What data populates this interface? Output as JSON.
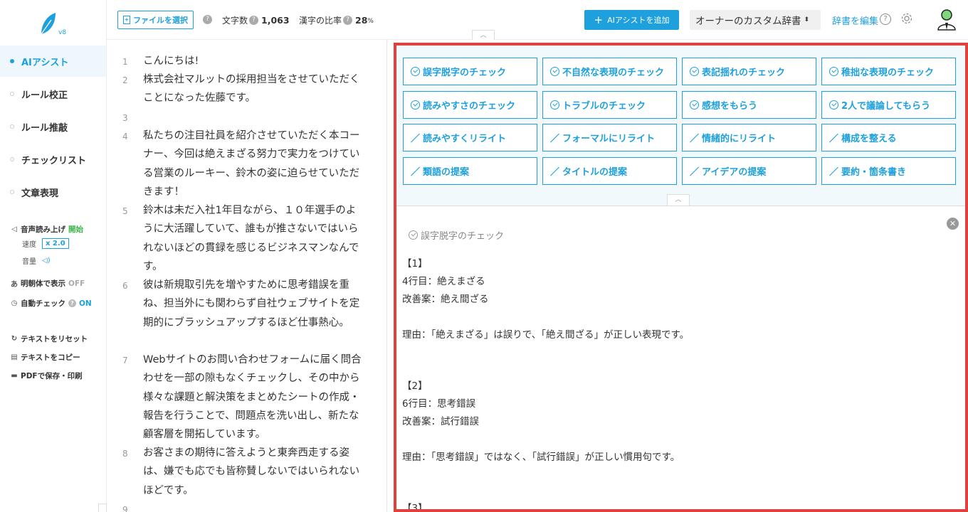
{
  "app": {
    "version": "v8",
    "brand_color": "#1ea0dc",
    "highlight_color": "#e0413c"
  },
  "sidebar": {
    "nav": [
      {
        "label": "AIアシスト",
        "active": true
      },
      {
        "label": "ルール校正",
        "active": false
      },
      {
        "label": "ルール推敲",
        "active": false
      },
      {
        "label": "チェックリスト",
        "active": false
      },
      {
        "label": "文章表現",
        "active": false
      }
    ],
    "tts": {
      "label": "音声読み上げ",
      "action": "開始",
      "speed_label": "速度",
      "speed_value": "x 2.0",
      "volume_label": "音量"
    },
    "mincho": {
      "label": "明朝体で表示",
      "state": "OFF"
    },
    "auto_check": {
      "label": "自動チェック",
      "state": "ON"
    },
    "actions": [
      {
        "label": "テキストをリセット",
        "icon": "reset-icon"
      },
      {
        "label": "テキストをコピー",
        "icon": "copy-icon"
      },
      {
        "label": "PDFで保存・印刷",
        "icon": "print-icon"
      }
    ]
  },
  "header": {
    "file_button": "ファイルを選択",
    "char_count_label": "文字数",
    "char_count_value": "1,063",
    "kanji_ratio_label": "漢字の比率",
    "kanji_ratio_value": "28",
    "kanji_ratio_unit": "%",
    "ai_add_button": "AIアシストを追加",
    "dict_select": "オーナーのカスタム辞書",
    "dict_edit_link": "辞書を編集"
  },
  "editor": {
    "lines": [
      {
        "num": "1",
        "text": "こんにちは!"
      },
      {
        "num": "2",
        "text": "株式会社マルットの採用担当をさせていただくことになった佐藤です。"
      },
      {
        "num": "3",
        "text": ""
      },
      {
        "num": "4",
        "text": "私たちの注目社員を紹介させていただく本コーナー、今回は絶えまざる努力で実力をつけている営業のルーキー、鈴木の姿に迫らせていただきます！"
      },
      {
        "num": "5",
        "text": "鈴木は未だ入社1年目ながら、１０年選手のように大活躍していて、誰もが推さないではいられないほどの貫録を感じるビジネスマンなんです。"
      },
      {
        "num": "6",
        "text": "彼は新規取引先を増やすために思考錯誤を重ね、担当外にも関わらず自社ウェブサイトを定期的にブラッシュアップするほど仕事熱心。"
      },
      {
        "num": "7",
        "text": "Webサイトのお問い合わせフォームに届く問合わせを一部の隙もなくチェックし、その中から様々な課題と解決策をまとめたシートの作成・報告を行うことで、問題点を洗い出し、新たな顧客層を開拓しています。"
      },
      {
        "num": "8",
        "text": "お客さまの期待に答えようと東奔西走する姿は、嫌でも応でも皆称賛しないではいられないほどです。"
      },
      {
        "num": "9",
        "text": ""
      }
    ]
  },
  "ai_buttons": [
    {
      "label": "誤字脱字のチェック",
      "icon": "check-circle-icon"
    },
    {
      "label": "不自然な表現のチェック",
      "icon": "check-circle-icon"
    },
    {
      "label": "表記揺れのチェック",
      "icon": "check-circle-icon"
    },
    {
      "label": "稚拙な表現のチェック",
      "icon": "check-circle-icon"
    },
    {
      "label": "読みやすさのチェック",
      "icon": "check-circle-icon"
    },
    {
      "label": "トラブルのチェック",
      "icon": "check-circle-icon"
    },
    {
      "label": "感想をもらう",
      "icon": "check-circle-icon"
    },
    {
      "label": "2人で議論してもらう",
      "icon": "check-circle-icon"
    },
    {
      "label": "読みやすくリライト",
      "icon": "pencil-icon"
    },
    {
      "label": "フォーマルにリライト",
      "icon": "pencil-icon"
    },
    {
      "label": "情緒的にリライト",
      "icon": "pencil-icon"
    },
    {
      "label": "構成を整える",
      "icon": "pencil-icon"
    },
    {
      "label": "類語の提案",
      "icon": "pencil-icon"
    },
    {
      "label": "タイトルの提案",
      "icon": "pencil-icon"
    },
    {
      "label": "アイデアの提案",
      "icon": "pencil-icon"
    },
    {
      "label": "要約・箇条書き",
      "icon": "pencil-icon"
    }
  ],
  "result": {
    "title": "誤字脱字のチェック",
    "lines": [
      "【1】",
      "4行目：絶えまざる",
      "改善案：絶え間ざる",
      "",
      "理由：「絶えまざる」は誤りで、「絶え間ざる」が正しい表現です。",
      "",
      "",
      "【2】",
      "6行目：思考錯誤",
      "改善案：試行錯誤",
      "",
      "理由：「思考錯誤」ではなく、「試行錯誤」が正しい慣用句です。",
      "",
      "",
      "【3】"
    ]
  }
}
